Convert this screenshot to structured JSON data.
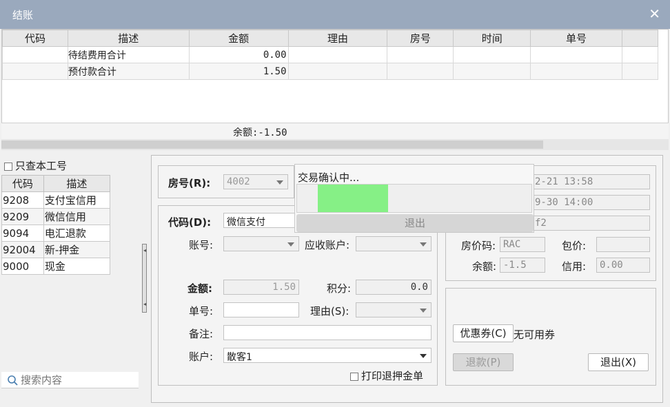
{
  "window": {
    "title": "结账"
  },
  "grid": {
    "columns": [
      "代码",
      "描述",
      "金额",
      "理由",
      "房号",
      "时间",
      "单号"
    ],
    "rows": [
      {
        "code": "",
        "desc": "待结费用合计",
        "amount": "0.00"
      },
      {
        "code": "",
        "desc": "预付款合计",
        "amount": "1.50"
      }
    ],
    "balance": "余额:-1.50"
  },
  "left": {
    "only_this_shift": "只查本工号",
    "columns": [
      "代码",
      "描述"
    ],
    "rows": [
      {
        "code": "9208",
        "desc": "支付宝信用"
      },
      {
        "code": "9209",
        "desc": "微信信用"
      },
      {
        "code": "9094",
        "desc": "电汇退款"
      },
      {
        "code": "92004",
        "desc": "新-押金"
      },
      {
        "code": "9000",
        "desc": "现金"
      }
    ],
    "search_placeholder": "搜索内容"
  },
  "form": {
    "room_label": "房号(R):",
    "room_value": "4002",
    "code_label": "代码(D):",
    "code_value": "微信支付",
    "account_label": "账号:",
    "ar_account_label": "应收账户:",
    "amount_label": "金额:",
    "amount_value": "1.50",
    "points_label": "积分:",
    "points_value": "0.0",
    "order_no_label": "单号:",
    "reason_label": "理由(S):",
    "remark_label": "备注:",
    "acct_label": "账户:",
    "acct_value": "散客1",
    "print_refund": "打印退押金单"
  },
  "right": {
    "time1": "2-21 13:58",
    "time2": "9-30 14:00",
    "info3": "f2",
    "rate_code_label": "房价码:",
    "rate_code_value": "RAC",
    "package_label": "包价:",
    "balance_label": "余额:",
    "balance_value": "-1.5",
    "credit_label": "信用:",
    "credit_value": "0.00",
    "coupon_button": "优惠券(C)",
    "coupon_status": "无可用券",
    "refund_button": "退款(P)",
    "exit_button": "退出(X)"
  },
  "popup": {
    "message": "交易确认中...",
    "progress": 0.3,
    "exit_label": "退出"
  },
  "colors": {
    "title_bar": "#9aa9bd",
    "progress_fill": "#86f086"
  }
}
